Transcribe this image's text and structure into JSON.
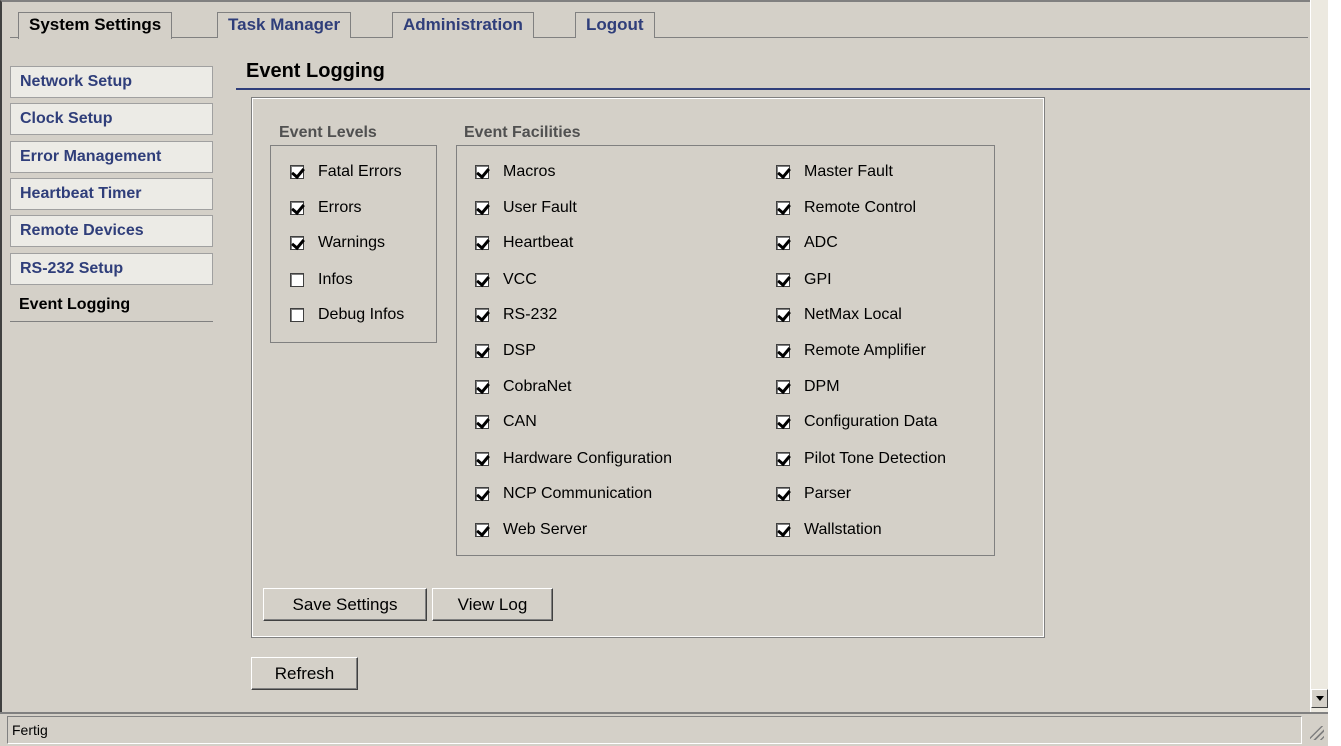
{
  "tabs": [
    {
      "label": "System Settings",
      "active": true
    },
    {
      "label": "Task Manager",
      "active": false
    },
    {
      "label": "Administration",
      "active": false
    },
    {
      "label": "Logout",
      "active": false
    }
  ],
  "sidebar": {
    "items": [
      {
        "label": "Network Setup"
      },
      {
        "label": "Clock Setup"
      },
      {
        "label": "Error Management"
      },
      {
        "label": "Heartbeat Timer"
      },
      {
        "label": "Remote Devices"
      },
      {
        "label": "RS-232 Setup"
      },
      {
        "label": "Event Logging",
        "active": true
      }
    ]
  },
  "page": {
    "title": "Event Logging"
  },
  "levels": {
    "title": "Event Levels",
    "items": [
      {
        "label": "Fatal Errors",
        "checked": true
      },
      {
        "label": "Errors",
        "checked": true
      },
      {
        "label": "Warnings",
        "checked": true
      },
      {
        "label": "Infos",
        "checked": false
      },
      {
        "label": "Debug Infos",
        "checked": false
      }
    ]
  },
  "facilities": {
    "title": "Event Facilities",
    "col1": [
      {
        "label": "Macros",
        "checked": true
      },
      {
        "label": "User Fault",
        "checked": true
      },
      {
        "label": "Heartbeat",
        "checked": true
      },
      {
        "label": "VCC",
        "checked": true
      },
      {
        "label": "RS-232",
        "checked": true
      },
      {
        "label": "DSP",
        "checked": true
      },
      {
        "label": "CobraNet",
        "checked": true
      },
      {
        "label": "CAN",
        "checked": true
      },
      {
        "label": "Hardware Configuration",
        "checked": true
      },
      {
        "label": "NCP Communication",
        "checked": true
      },
      {
        "label": "Web Server",
        "checked": true
      }
    ],
    "col2": [
      {
        "label": "Master Fault",
        "checked": true
      },
      {
        "label": "Remote Control",
        "checked": true
      },
      {
        "label": "ADC",
        "checked": true
      },
      {
        "label": "GPI",
        "checked": true
      },
      {
        "label": "NetMax Local",
        "checked": true
      },
      {
        "label": "Remote Amplifier",
        "checked": true
      },
      {
        "label": "DPM",
        "checked": true
      },
      {
        "label": "Configuration Data",
        "checked": true
      },
      {
        "label": "Pilot Tone Detection",
        "checked": true
      },
      {
        "label": "Parser",
        "checked": true
      },
      {
        "label": "Wallstation",
        "checked": true
      }
    ]
  },
  "buttons": {
    "save": "Save Settings",
    "view_log": "View Log",
    "refresh": "Refresh"
  },
  "status": {
    "text": "Fertig"
  }
}
